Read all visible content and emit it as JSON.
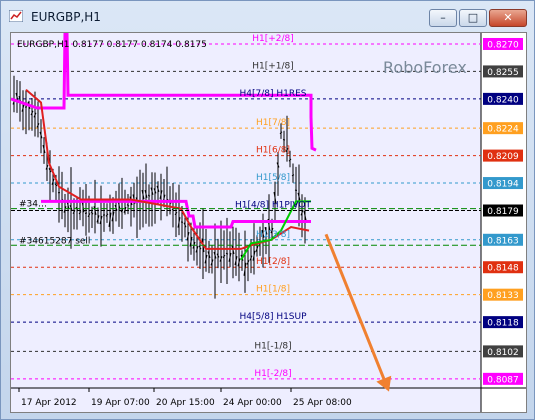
{
  "window": {
    "title": "EURGBP,H1",
    "minimize_glyph": "–",
    "maximize_glyph": "□",
    "close_glyph": "✕"
  },
  "header": {
    "symbol_line": "EURGBP,H1  0.8177 0.8177 0.8174 0.8175",
    "watermark": "RoboForex"
  },
  "colors": {
    "background": "#eeeeff",
    "candles": "#000000",
    "murrey_upper": "#ff00ff",
    "h1_line": "#e02020",
    "green_line": "#00cc00",
    "arrow": "#f08030",
    "price_label_current": "#000000"
  },
  "chart_data": {
    "type": "candlestick",
    "symbol": "EURGBP",
    "timeframe": "H1",
    "ohlc_header": {
      "open": 0.8177,
      "high": 0.8177,
      "low": 0.8174,
      "close": 0.8175
    },
    "ylim": [
      0.8082,
      0.8276
    ],
    "price_ticks": [
      0.827,
      0.8255,
      0.824,
      0.8224,
      0.8209,
      0.8194,
      0.8179,
      0.8163,
      0.8148,
      0.8133,
      0.8118,
      0.8102,
      0.8087
    ],
    "x_ticks": [
      "17 Apr 2012",
      "19 Apr 07:00",
      "20 Apr 15:00",
      "24 Apr 00:00",
      "25 Apr 08:00"
    ],
    "current_price": 0.8179,
    "murrey_levels": [
      {
        "label": "H1[+2/8]",
        "price": 0.827,
        "color": "#ff00ff",
        "style": "dashed"
      },
      {
        "label": "H1[+1/8]",
        "price": 0.8255,
        "color": "#303030",
        "style": "dashed"
      },
      {
        "label": "H4[7/8] H1RES",
        "price": 0.824,
        "color": "#000080",
        "style": "dashed"
      },
      {
        "label": "H1[7/8]",
        "price": 0.8224,
        "color": "#ffa020",
        "style": "dashed"
      },
      {
        "label": "H1[6/8]",
        "price": 0.8209,
        "color": "#e03010",
        "style": "dashed"
      },
      {
        "label": "H1[5/8]",
        "price": 0.8194,
        "color": "#3399cc",
        "style": "dashed"
      },
      {
        "label": "H1[4/8] H1PIVOT",
        "price": 0.8179,
        "color": "#000080",
        "style": "dashed"
      },
      {
        "label": "H1[3/8]",
        "price": 0.8163,
        "color": "#3399cc",
        "style": "dashed"
      },
      {
        "label": "H1[2/8]",
        "price": 0.8148,
        "color": "#e03010",
        "style": "dashed"
      },
      {
        "label": "H1[1/8]",
        "price": 0.8133,
        "color": "#ffa020",
        "style": "dashed"
      },
      {
        "label": "H4[5/8] H1SUP",
        "price": 0.8118,
        "color": "#000080",
        "style": "dashed"
      },
      {
        "label": "H1[-1/8]",
        "price": 0.8102,
        "color": "#303030",
        "style": "dashed"
      },
      {
        "label": "H1[-2/8]",
        "price": 0.8087,
        "color": "#ff00ff",
        "style": "dashed"
      }
    ],
    "price_label_colors": [
      "#ff00ff",
      "#404040",
      "#000080",
      "#ffa020",
      "#e03010",
      "#3399cc",
      "#000000",
      "#3399cc",
      "#e03010",
      "#ffa020",
      "#000080",
      "#404040",
      "#ff00ff"
    ],
    "orders": [
      {
        "label": "#34…",
        "price": 0.818
      },
      {
        "label": "#34615287 sell",
        "price": 0.816
      }
    ],
    "magenta_line": [
      [
        0,
        0.824
      ],
      [
        26,
        0.8235
      ],
      [
        53,
        0.8235
      ],
      [
        54,
        0.8276
      ],
      [
        56,
        0.8276
      ],
      [
        57,
        0.8242
      ],
      [
        300,
        0.8242
      ],
      [
        300,
        0.823
      ],
      [
        301,
        0.8213
      ],
      [
        305,
        0.8212
      ]
    ],
    "magenta_line_lower": [
      [
        30,
        0.8184
      ],
      [
        175,
        0.8184
      ],
      [
        178,
        0.8176
      ],
      [
        182,
        0.8176
      ],
      [
        184,
        0.817
      ],
      [
        220,
        0.817
      ],
      [
        222,
        0.8173
      ],
      [
        300,
        0.8173
      ]
    ],
    "red_line": [
      [
        15,
        0.8245
      ],
      [
        30,
        0.8238
      ],
      [
        38,
        0.8205
      ],
      [
        48,
        0.8192
      ],
      [
        70,
        0.8185
      ],
      [
        120,
        0.8185
      ],
      [
        170,
        0.818
      ],
      [
        180,
        0.817
      ],
      [
        195,
        0.8158
      ],
      [
        230,
        0.8158
      ],
      [
        240,
        0.816
      ],
      [
        260,
        0.8163
      ],
      [
        280,
        0.817
      ],
      [
        298,
        0.8168
      ]
    ],
    "green_line": [
      [
        230,
        0.8152
      ],
      [
        240,
        0.8161
      ],
      [
        260,
        0.8163
      ],
      [
        270,
        0.8168
      ],
      [
        285,
        0.8184
      ],
      [
        300,
        0.8184
      ]
    ],
    "arrow": {
      "from": [
        315,
        0.8166
      ],
      "to": [
        378,
        0.808
      ]
    }
  }
}
